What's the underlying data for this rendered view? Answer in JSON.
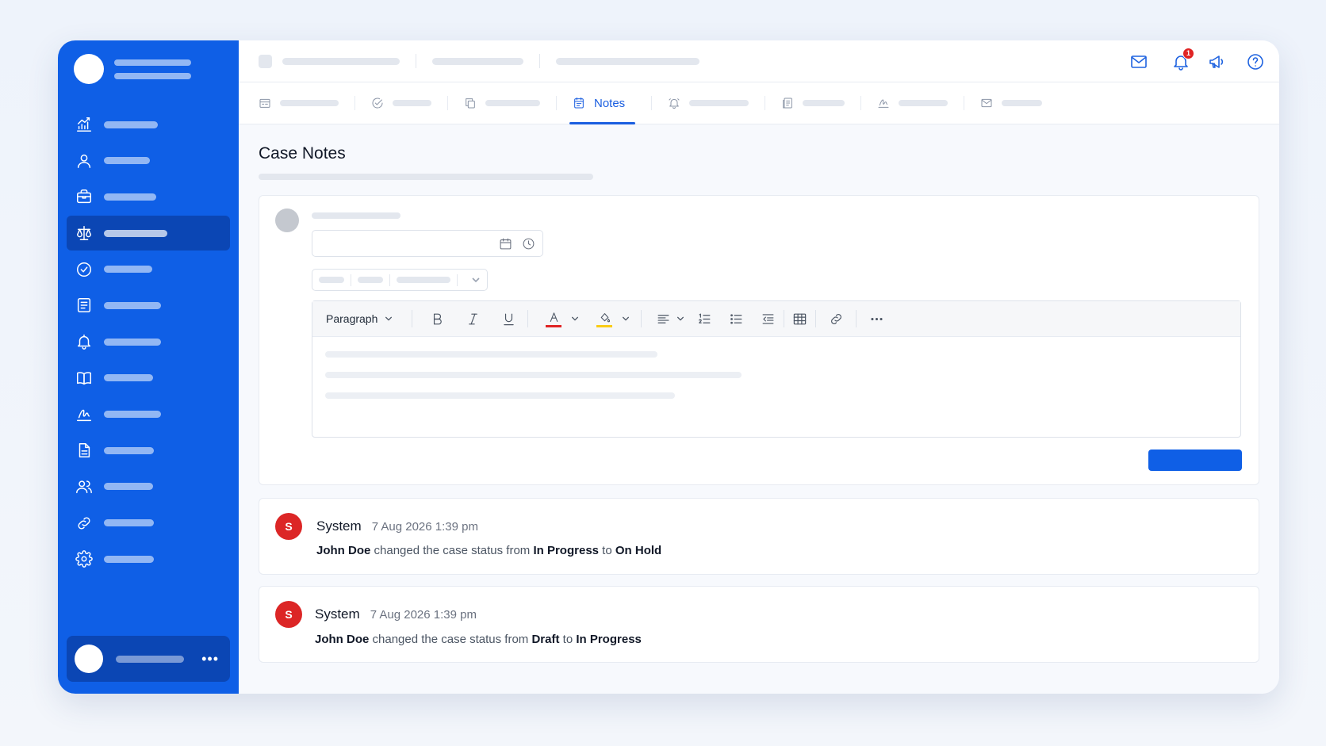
{
  "topbar": {
    "notification_count": "1",
    "icons": [
      "mail-icon",
      "bell-icon",
      "megaphone-icon",
      "help-icon"
    ]
  },
  "tabs": [
    {
      "icon": "calendar-grid-icon",
      "label": ""
    },
    {
      "icon": "check-circle-icon",
      "label": ""
    },
    {
      "icon": "copy-icon",
      "label": ""
    },
    {
      "icon": "notes-icon",
      "label": "Notes",
      "active": true
    },
    {
      "icon": "bell-icon",
      "label": ""
    },
    {
      "icon": "document-icon",
      "label": ""
    },
    {
      "icon": "signature-icon",
      "label": ""
    },
    {
      "icon": "mail-icon",
      "label": ""
    }
  ],
  "sidebar": {
    "items": [
      {
        "icon": "chart-icon"
      },
      {
        "icon": "user-icon"
      },
      {
        "icon": "briefcase-icon"
      },
      {
        "icon": "scale-icon",
        "active": true
      },
      {
        "icon": "check-circle-icon"
      },
      {
        "icon": "list-icon"
      },
      {
        "icon": "bell-icon"
      },
      {
        "icon": "book-icon"
      },
      {
        "icon": "signature-icon"
      },
      {
        "icon": "document-icon"
      },
      {
        "icon": "users-icon"
      },
      {
        "icon": "link-icon"
      },
      {
        "icon": "gear-icon"
      }
    ],
    "user_more": "•••"
  },
  "page": {
    "title": "Case Notes"
  },
  "editor": {
    "block_format": "Paragraph",
    "text_color": "#e02424",
    "highlight_color": "#facc15"
  },
  "activity": [
    {
      "avatar_letter": "S",
      "author": "System",
      "time": "7 Aug 2026 1:39 pm",
      "actor": "John Doe",
      "action": "changed the case status from",
      "from": "In Progress",
      "to_word": "to",
      "to": "On Hold"
    },
    {
      "avatar_letter": "S",
      "author": "System",
      "time": "7 Aug 2026 1:39 pm",
      "actor": "John Doe",
      "action": "changed the case status from",
      "from": "Draft",
      "to_word": "to",
      "to": "In Progress"
    }
  ],
  "colors": {
    "sidebar": "#0f5fe6",
    "sidebar_active": "#0b46b4",
    "accent": "#1a5ee0",
    "avatar_system": "#dc2626",
    "badge": "#e02424"
  }
}
